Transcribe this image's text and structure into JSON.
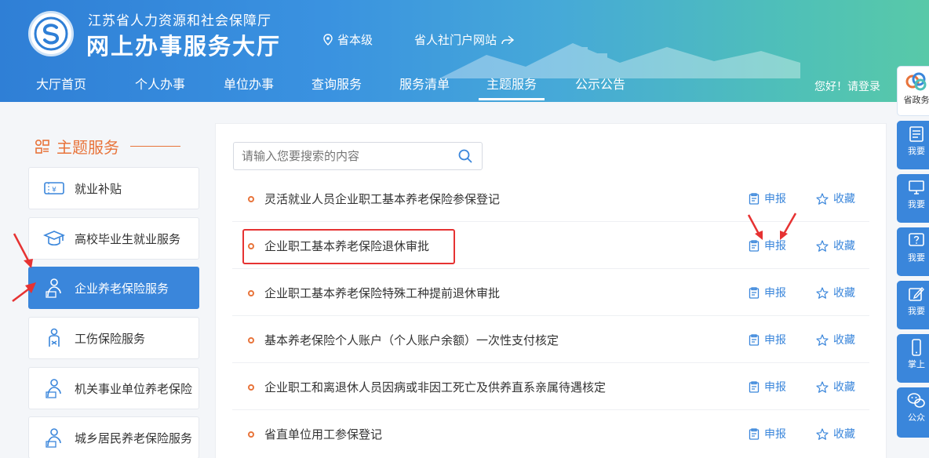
{
  "header": {
    "org_name": "江苏省人力资源和社会保障厅",
    "site_title": "网上办事服务大厅",
    "level": "省本级",
    "portal_link": "省人社门户网站",
    "login_text": "您好！请登录"
  },
  "nav": [
    {
      "label": "大厅首页"
    },
    {
      "label": "个人办事"
    },
    {
      "label": "单位办事"
    },
    {
      "label": "查询服务"
    },
    {
      "label": "服务清单"
    },
    {
      "label": "主题服务",
      "active": true
    },
    {
      "label": "公示公告"
    }
  ],
  "sidebar": {
    "title": "主题服务",
    "items": [
      {
        "label": "就业补贴",
        "icon": "ticket-icon"
      },
      {
        "label": "高校毕业生就业服务",
        "icon": "graduation-cap-icon"
      },
      {
        "label": "企业养老保险服务",
        "icon": "elder-person-icon",
        "active": true
      },
      {
        "label": "工伤保险服务",
        "icon": "injury-person-icon"
      },
      {
        "label": "机关事业单位养老保险",
        "icon": "elder-person-icon"
      },
      {
        "label": "城乡居民养老保险服务",
        "icon": "elder-person-icon"
      }
    ]
  },
  "search": {
    "placeholder": "请输入您要搜索的内容"
  },
  "list": {
    "apply_label": "申报",
    "fav_label": "收藏",
    "items": [
      {
        "title": "灵活就业人员企业职工基本养老保险参保登记"
      },
      {
        "title": "企业职工基本养老保险退休审批",
        "highlighted": true
      },
      {
        "title": "企业职工基本养老保险特殊工种提前退休审批"
      },
      {
        "title": "基本养老保险个人账户（个人账户余额）一次性支付核定"
      },
      {
        "title": "企业职工和离退休人员因病或非因工死亡及供养直系亲属待遇核定"
      },
      {
        "title": "省直单位用工参保登记"
      }
    ]
  },
  "float_bar": [
    {
      "label": "省政务",
      "icon": "colorful-logo-icon"
    },
    {
      "label": "我要",
      "icon": "document-list-icon"
    },
    {
      "label": "我要",
      "icon": "monitor-icon"
    },
    {
      "label": "我要",
      "icon": "question-icon"
    },
    {
      "label": "我要",
      "icon": "edit-icon"
    },
    {
      "label": "掌上",
      "icon": "phone-icon"
    },
    {
      "label": "公众",
      "icon": "wechat-icon"
    }
  ],
  "colors": {
    "primary": "#3a86db",
    "accent_orange": "#e8743b",
    "highlight_red": "#e63232"
  }
}
